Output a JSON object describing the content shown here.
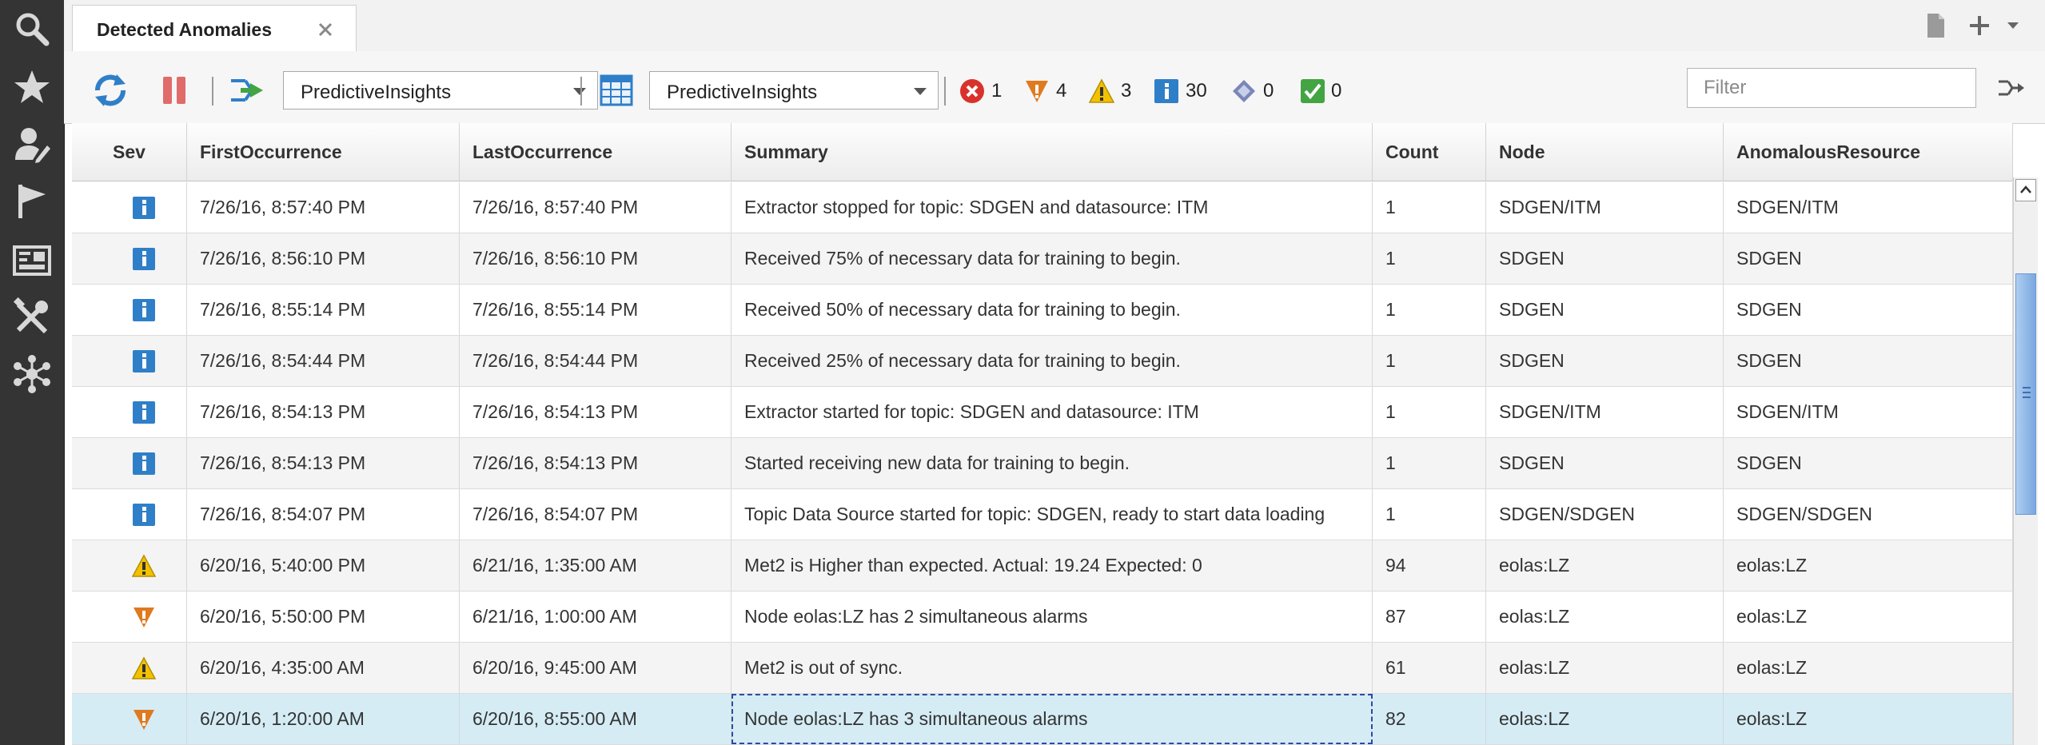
{
  "rail": {
    "items": [
      "search-icon",
      "favorites-star-icon",
      "user-edit-icon",
      "flag-icon",
      "dashboard-icon",
      "tools-icon",
      "network-icon"
    ]
  },
  "tab": {
    "title": "Detected Anomalies"
  },
  "toolbar": {
    "datasource_combo": "PredictiveInsights",
    "view_combo": "PredictiveInsights",
    "severity_counts": {
      "critical": "1",
      "major": "4",
      "minor": "3",
      "info": "30",
      "indeterminate": "0",
      "clear": "0"
    },
    "filter_placeholder": "Filter"
  },
  "columns": [
    "Sev",
    "FirstOccurrence",
    "LastOccurrence",
    "Summary",
    "Count",
    "Node",
    "AnomalousResource"
  ],
  "rows": [
    {
      "sev": "info",
      "first": "7/26/16, 8:57:40 PM",
      "last": "7/26/16, 8:57:40 PM",
      "summary": "Extractor stopped for topic: SDGEN and datasource: ITM",
      "count": "1",
      "node": "SDGEN/ITM",
      "resource": "SDGEN/ITM"
    },
    {
      "sev": "info",
      "first": "7/26/16, 8:56:10 PM",
      "last": "7/26/16, 8:56:10 PM",
      "summary": "Received 75% of necessary data for training to begin.",
      "count": "1",
      "node": "SDGEN",
      "resource": "SDGEN"
    },
    {
      "sev": "info",
      "first": "7/26/16, 8:55:14 PM",
      "last": "7/26/16, 8:55:14 PM",
      "summary": "Received 50% of necessary data for training to begin.",
      "count": "1",
      "node": "SDGEN",
      "resource": "SDGEN"
    },
    {
      "sev": "info",
      "first": "7/26/16, 8:54:44 PM",
      "last": "7/26/16, 8:54:44 PM",
      "summary": "Received 25% of necessary data for training to begin.",
      "count": "1",
      "node": "SDGEN",
      "resource": "SDGEN"
    },
    {
      "sev": "info",
      "first": "7/26/16, 8:54:13 PM",
      "last": "7/26/16, 8:54:13 PM",
      "summary": "Extractor started for topic: SDGEN and datasource: ITM",
      "count": "1",
      "node": "SDGEN/ITM",
      "resource": "SDGEN/ITM"
    },
    {
      "sev": "info",
      "first": "7/26/16, 8:54:13 PM",
      "last": "7/26/16, 8:54:13 PM",
      "summary": "Started receiving new data for training to begin.",
      "count": "1",
      "node": "SDGEN",
      "resource": "SDGEN"
    },
    {
      "sev": "info",
      "first": "7/26/16, 8:54:07 PM",
      "last": "7/26/16, 8:54:07 PM",
      "summary": "Topic Data Source started for topic: SDGEN, ready to start data loading",
      "count": "1",
      "node": "SDGEN/SDGEN",
      "resource": "SDGEN/SDGEN"
    },
    {
      "sev": "minor",
      "first": "6/20/16, 5:40:00 PM",
      "last": "6/21/16, 1:35:00 AM",
      "summary": "Met2 is Higher than expected. Actual: 19.24 Expected: 0",
      "count": "94",
      "node": "eolas:LZ",
      "resource": "eolas:LZ"
    },
    {
      "sev": "major",
      "first": "6/20/16, 5:50:00 PM",
      "last": "6/21/16, 1:00:00 AM",
      "summary": "Node eolas:LZ has 2 simultaneous alarms",
      "count": "87",
      "node": "eolas:LZ",
      "resource": "eolas:LZ"
    },
    {
      "sev": "minor",
      "first": "6/20/16, 4:35:00 AM",
      "last": "6/20/16, 9:45:00 AM",
      "summary": "Met2 is out of sync.",
      "count": "61",
      "node": "eolas:LZ",
      "resource": "eolas:LZ"
    },
    {
      "sev": "major",
      "first": "6/20/16, 1:20:00 AM",
      "last": "6/20/16, 8:55:00 AM",
      "summary": "Node eolas:LZ has 3 simultaneous alarms",
      "count": "82",
      "node": "eolas:LZ",
      "resource": "eolas:LZ"
    }
  ],
  "selected_row": 10,
  "colors": {
    "rail": "#343434",
    "selected_row": "#d5ecf5",
    "critical": "#d9322c",
    "major": "#e07a1f",
    "minor": "#f2c200",
    "info": "#2f7fc8",
    "indeterminate": "#7b86b8",
    "clear": "#43a443"
  }
}
